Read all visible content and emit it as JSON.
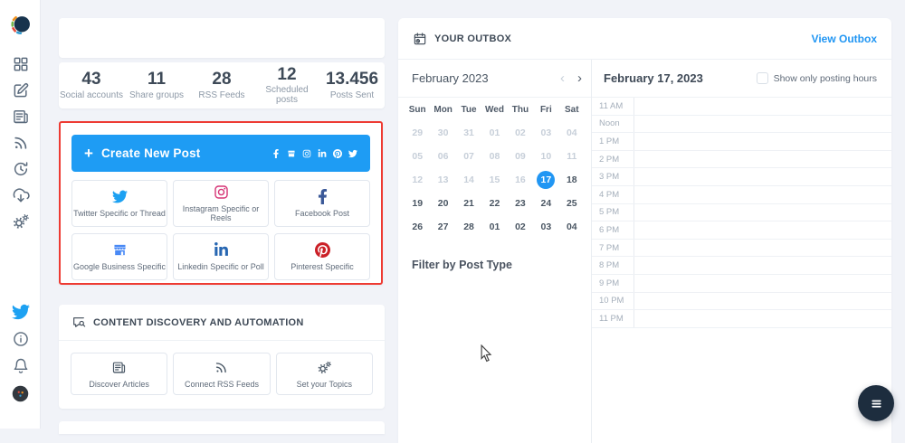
{
  "colors": {
    "accent_blue": "#2196f3",
    "create_button_blue": "#1e9cf4",
    "highlight_red": "#ee3b33",
    "twitter_blue": "#1da1f2",
    "facebook_navy": "#3b5998",
    "instagram_pink": "#d63576",
    "linkedin_blue": "#2867b2",
    "pinterest_red": "#cb2027",
    "google_blue": "#4989f5",
    "fab_navy": "#1d2d3e"
  },
  "sidebar": {
    "top_items": [
      {
        "icon": "logo-icon",
        "name": "app-logo"
      },
      {
        "icon": "dashboard-icon",
        "name": "nav-dashboard"
      },
      {
        "icon": "compose-icon",
        "name": "nav-compose"
      },
      {
        "icon": "articles-icon",
        "name": "nav-content"
      },
      {
        "icon": "rss-icon",
        "name": "nav-rss-feeds"
      },
      {
        "icon": "history-icon",
        "name": "nav-schedule"
      },
      {
        "icon": "cloud-download-icon",
        "name": "nav-import"
      },
      {
        "icon": "gears-icon",
        "name": "nav-settings"
      }
    ],
    "bottom_items": [
      {
        "icon": "twitter-bird-icon",
        "name": "nav-twitter-profile"
      },
      {
        "icon": "info-icon",
        "name": "nav-help"
      },
      {
        "icon": "bell-icon",
        "name": "nav-notifications"
      },
      {
        "icon": "avatar",
        "name": "user-avatar"
      }
    ]
  },
  "stats": {
    "items": [
      {
        "value": "43",
        "label": "Social accounts"
      },
      {
        "value": "11",
        "label": "Share groups"
      },
      {
        "value": "28",
        "label": "RSS Feeds"
      },
      {
        "value": "12",
        "label": "Scheduled posts"
      },
      {
        "value": "13.456",
        "label": "Posts Sent"
      }
    ]
  },
  "create_post": {
    "label": "Create New Post",
    "plus": "+",
    "network_icons": [
      "facebook-icon",
      "google-business-icon",
      "instagram-icon",
      "linkedin-icon",
      "pinterest-icon",
      "twitter-bird-icon"
    ]
  },
  "post_types": {
    "items": [
      {
        "icon": "twitter-bird-icon",
        "label": "Twitter Specific or Thread"
      },
      {
        "icon": "instagram-icon",
        "label": "Instagram Specific or Reels"
      },
      {
        "icon": "facebook-icon",
        "label": "Facebook Post"
      },
      {
        "icon": "google-business-icon",
        "label": "Google Business Specific"
      },
      {
        "icon": "linkedin-icon",
        "label": "Linkedin Specific or Poll"
      },
      {
        "icon": "pinterest-icon",
        "label": "Pinterest Specific"
      }
    ]
  },
  "discovery": {
    "title": "CONTENT DISCOVERY AND AUTOMATION",
    "items": [
      {
        "icon": "articles-icon",
        "label": "Discover Articles"
      },
      {
        "icon": "rss-icon",
        "label": "Connect RSS Feeds"
      },
      {
        "icon": "gears-icon",
        "label": "Set your Topics"
      }
    ]
  },
  "outbox": {
    "title": "YOUR OUTBOX",
    "view_link": "View Outbox",
    "calendar": {
      "month": "February 2023",
      "prev": "‹",
      "next": "›",
      "day_names": [
        "Sun",
        "Mon",
        "Tue",
        "Wed",
        "Thu",
        "Fri",
        "Sat"
      ],
      "weeks": [
        [
          {
            "d": "29",
            "s": "muted"
          },
          {
            "d": "30",
            "s": "muted"
          },
          {
            "d": "31",
            "s": "muted"
          },
          {
            "d": "01",
            "s": "muted"
          },
          {
            "d": "02",
            "s": "muted"
          },
          {
            "d": "03",
            "s": "muted"
          },
          {
            "d": "04",
            "s": "muted"
          }
        ],
        [
          {
            "d": "05",
            "s": "muted"
          },
          {
            "d": "06",
            "s": "muted"
          },
          {
            "d": "07",
            "s": "muted"
          },
          {
            "d": "08",
            "s": "muted"
          },
          {
            "d": "09",
            "s": "muted"
          },
          {
            "d": "10",
            "s": "muted"
          },
          {
            "d": "11",
            "s": "muted"
          }
        ],
        [
          {
            "d": "12",
            "s": "muted"
          },
          {
            "d": "13",
            "s": "muted"
          },
          {
            "d": "14",
            "s": "muted"
          },
          {
            "d": "15",
            "s": "muted"
          },
          {
            "d": "16",
            "s": "muted"
          },
          {
            "d": "17",
            "s": "selected"
          },
          {
            "d": "18",
            "s": "normal"
          }
        ],
        [
          {
            "d": "19",
            "s": "normal"
          },
          {
            "d": "20",
            "s": "normal"
          },
          {
            "d": "21",
            "s": "normal"
          },
          {
            "d": "22",
            "s": "normal"
          },
          {
            "d": "23",
            "s": "normal"
          },
          {
            "d": "24",
            "s": "normal"
          },
          {
            "d": "25",
            "s": "normal"
          }
        ],
        [
          {
            "d": "26",
            "s": "normal"
          },
          {
            "d": "27",
            "s": "normal"
          },
          {
            "d": "28",
            "s": "normal"
          },
          {
            "d": "01",
            "s": "normal"
          },
          {
            "d": "02",
            "s": "normal"
          },
          {
            "d": "03",
            "s": "normal"
          },
          {
            "d": "04",
            "s": "normal"
          }
        ]
      ],
      "filter_label": "Filter by Post Type"
    },
    "day_view": {
      "title": "February 17, 2023",
      "checkbox_label": "Show only posting hours",
      "checkbox_checked": false,
      "times": [
        "11 AM",
        "Noon",
        "1 PM",
        "2 PM",
        "3 PM",
        "4 PM",
        "5 PM",
        "6 PM",
        "7 PM",
        "8 PM",
        "9 PM",
        "10 PM",
        "11 PM"
      ]
    }
  }
}
